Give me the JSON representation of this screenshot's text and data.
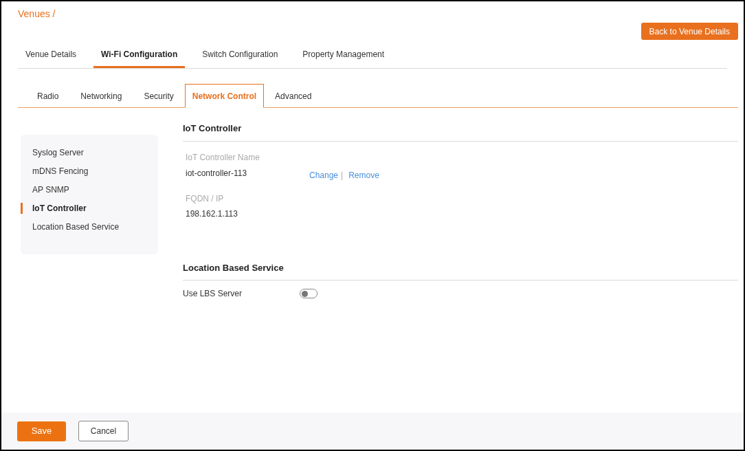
{
  "breadcrumb": "Venues /",
  "back_button": "Back to Venue Details",
  "tabs": [
    {
      "label": "Venue Details",
      "selected": false
    },
    {
      "label": "Wi-Fi Configuration",
      "selected": true
    },
    {
      "label": "Switch Configuration",
      "selected": false
    },
    {
      "label": "Property Management",
      "selected": false
    }
  ],
  "sub_tabs": [
    {
      "label": "Radio",
      "selected": false
    },
    {
      "label": "Networking",
      "selected": false
    },
    {
      "label": "Security",
      "selected": false
    },
    {
      "label": "Network Control",
      "selected": true
    },
    {
      "label": "Advanced",
      "selected": false
    }
  ],
  "sidebar": {
    "items": [
      {
        "label": "Syslog Server",
        "selected": false
      },
      {
        "label": "mDNS Fencing",
        "selected": false
      },
      {
        "label": "AP SNMP",
        "selected": false
      },
      {
        "label": "IoT Controller",
        "selected": true
      },
      {
        "label": "Location Based Service",
        "selected": false
      }
    ]
  },
  "iot_controller": {
    "title": "IoT Controller",
    "name_label": "IoT Controller Name",
    "name_value": "iot-controller-113",
    "change_link": "Change",
    "separator": "|",
    "remove_link": "Remove",
    "ip_label": "FQDN / IP",
    "ip_value": "198.162.1.113"
  },
  "location_based_service": {
    "title": "Location Based Service",
    "toggle_label": "Use LBS Server",
    "on": false
  },
  "footer": {
    "save": "Save",
    "cancel": "Cancel"
  }
}
